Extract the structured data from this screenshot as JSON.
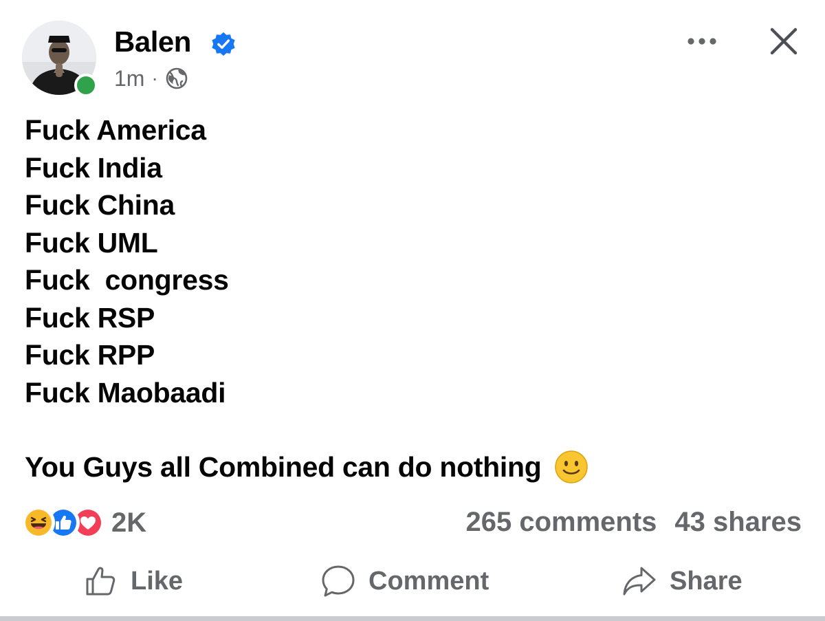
{
  "post": {
    "author": {
      "name": "Balen",
      "verified_icon": "verified-badge-icon",
      "online": true,
      "avatar_icon": "profile-photo"
    },
    "meta": {
      "time": "1m",
      "separator": "·",
      "audience_icon": "globe-icon"
    },
    "lines": [
      "Fuck America",
      "Fuck India",
      "Fuck China",
      "Fuck UML",
      "Fuck  congress",
      "Fuck RSP",
      "Fuck RPP",
      "Fuck Maobaadi"
    ],
    "closing_line": "You Guys all Combined can do nothing",
    "closing_emoji": "slightly-smiling-face-emoji"
  },
  "stats": {
    "reaction_icons": [
      "haha-icon",
      "like-reaction-icon",
      "love-icon"
    ],
    "reaction_count": "2K",
    "comments": "265 comments",
    "shares": "43 shares"
  },
  "actions": {
    "like_label": "Like",
    "comment_label": "Comment",
    "share_label": "Share"
  },
  "colors": {
    "text": "#050505",
    "secondary_text": "#65676b",
    "verified_blue": "#1877f2",
    "online_green": "#31a24c",
    "love_red": "#f33e58",
    "emoji_yellow": "#f7b928"
  }
}
